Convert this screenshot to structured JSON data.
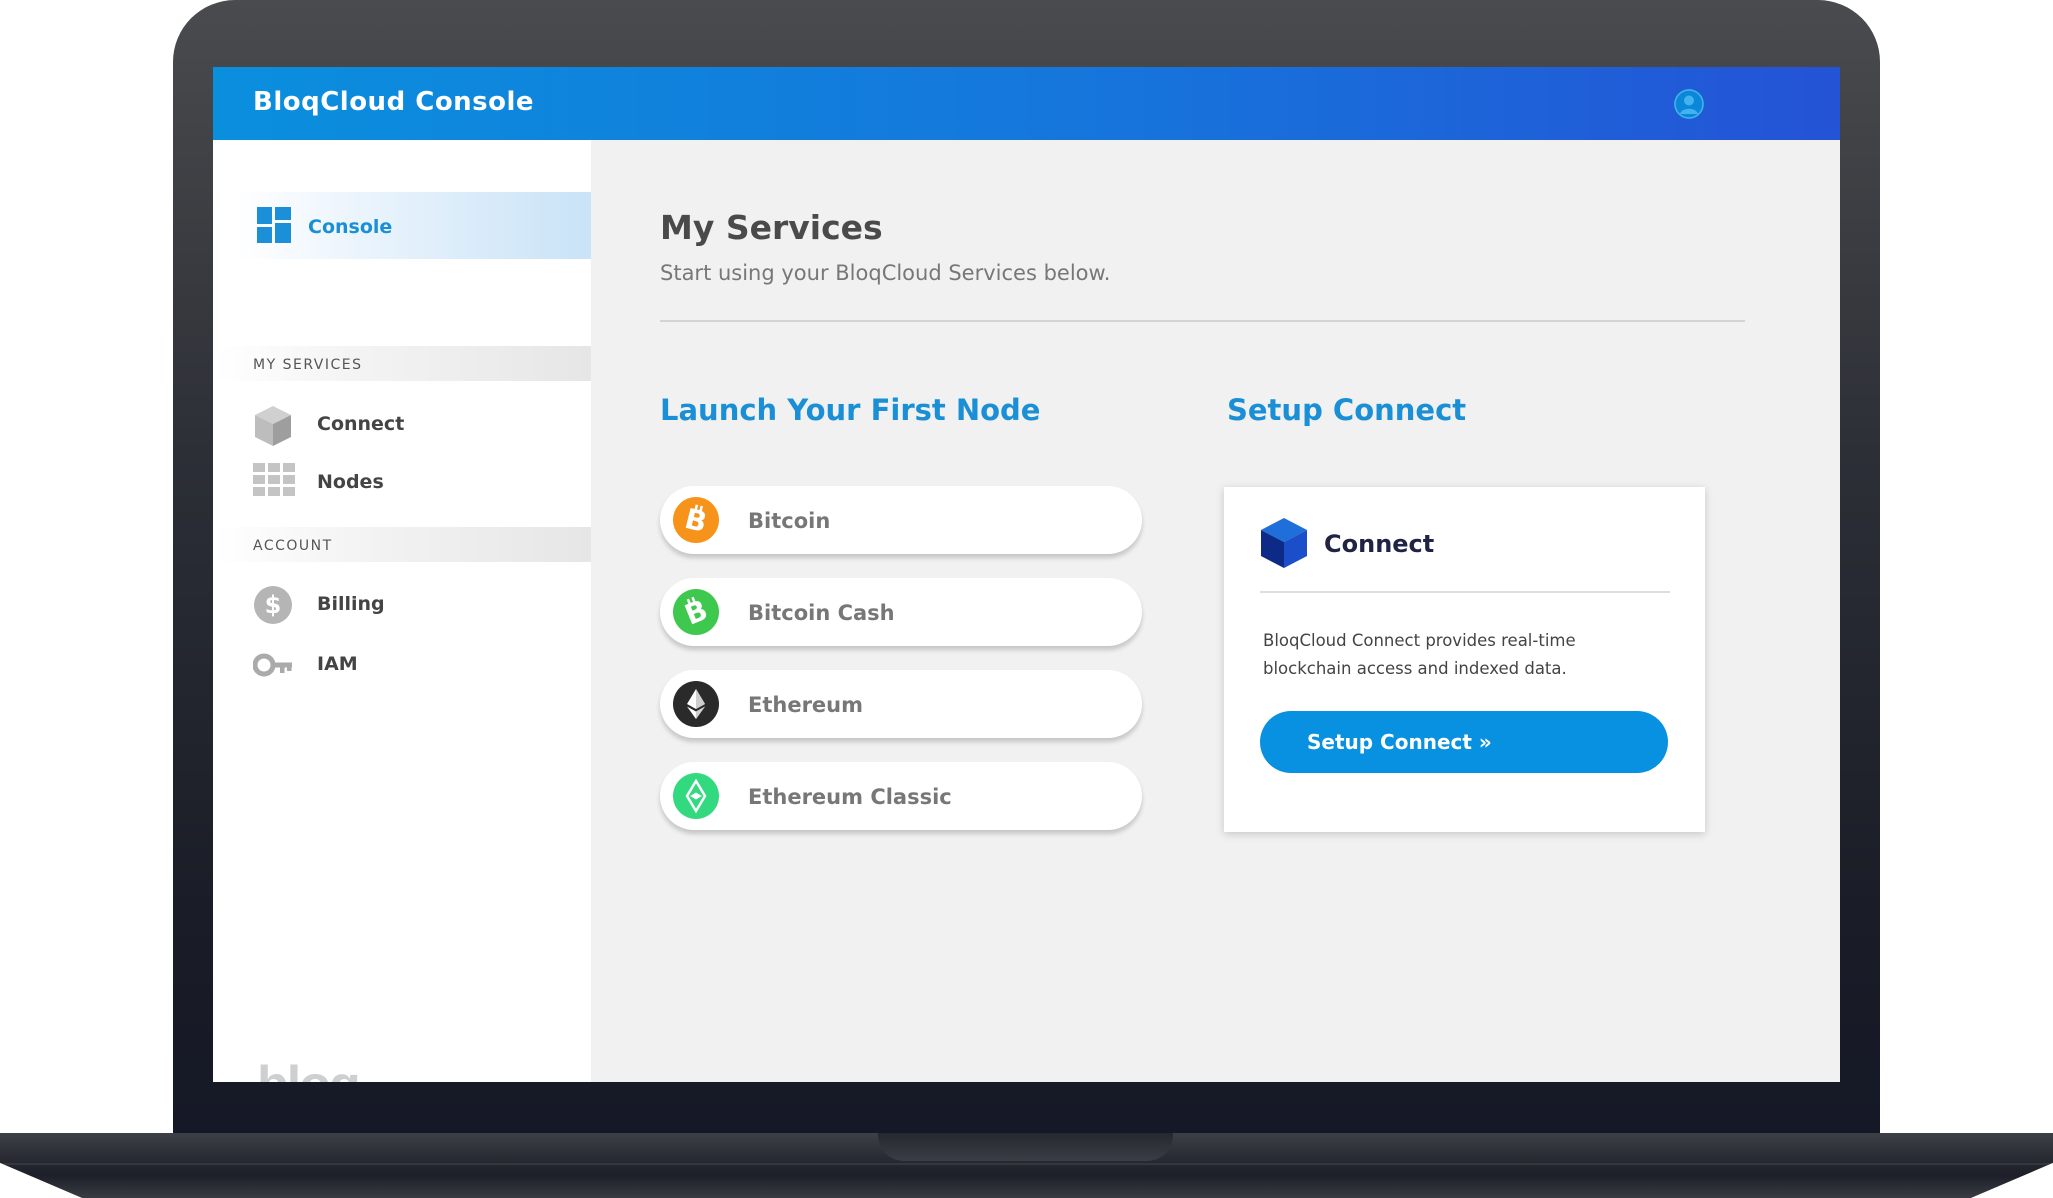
{
  "header": {
    "title": "BloqCloud Console"
  },
  "sidebar": {
    "console_label": "Console",
    "sections": [
      {
        "title": "MY SERVICES",
        "items": [
          {
            "label": "Connect",
            "icon": "cube-icon"
          },
          {
            "label": "Nodes",
            "icon": "grid-icon"
          }
        ]
      },
      {
        "title": "ACCOUNT",
        "items": [
          {
            "label": "Billing",
            "icon": "dollar-icon"
          },
          {
            "label": "IAM",
            "icon": "key-icon"
          }
        ]
      }
    ],
    "logo_text": "bloq"
  },
  "main": {
    "title": "My Services",
    "subtitle": "Start using your BloqCloud Services below.",
    "nodes": {
      "title": "Launch Your First Node",
      "items": [
        {
          "label": "Bitcoin",
          "icon": "bitcoin-icon",
          "color": "#f7931a"
        },
        {
          "label": "Bitcoin Cash",
          "icon": "bitcoin-cash-icon",
          "color": "#3ec84d"
        },
        {
          "label": "Ethereum",
          "icon": "ethereum-icon",
          "color": "#2a2a2a"
        },
        {
          "label": "Ethereum Classic",
          "icon": "ethereum-classic-icon",
          "color": "#33d97f"
        }
      ]
    },
    "connect": {
      "title": "Setup Connect",
      "card_title": "Connect",
      "description": "BloqCloud Connect provides real-time blockchain access and indexed data.",
      "button_label": "Setup Connect »"
    }
  },
  "colors": {
    "accent": "#1a8fd6",
    "header_start": "#0a8fdd",
    "header_end": "#2453d6",
    "button": "#0891e0"
  }
}
